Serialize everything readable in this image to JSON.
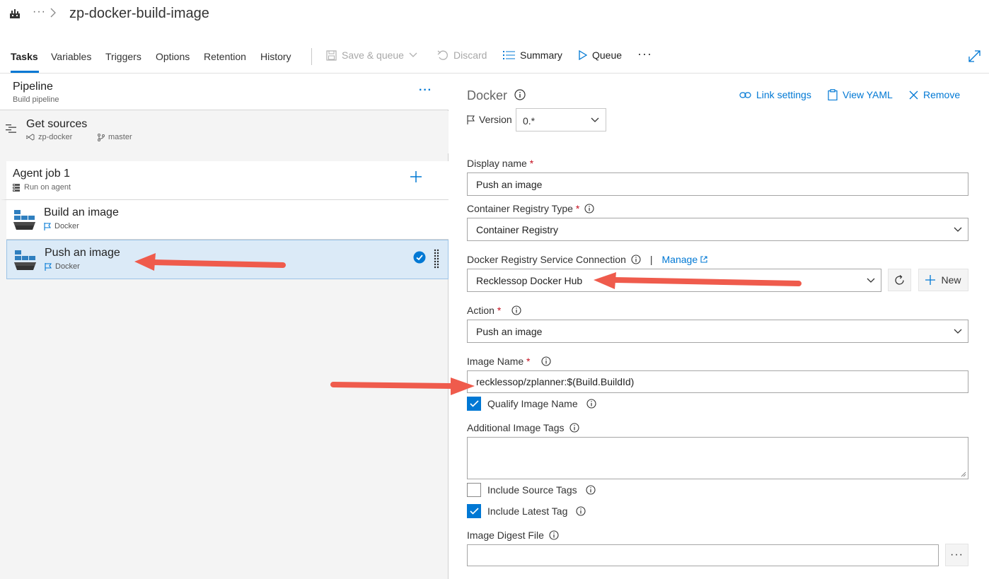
{
  "header": {
    "title": "zp-docker-build-image",
    "more": "···"
  },
  "tabs": [
    {
      "label": "Tasks",
      "active": true
    },
    {
      "label": "Variables"
    },
    {
      "label": "Triggers"
    },
    {
      "label": "Options"
    },
    {
      "label": "Retention"
    },
    {
      "label": "History"
    }
  ],
  "toolbar": {
    "save_queue": "Save & queue",
    "discard": "Discard",
    "summary": "Summary",
    "queue": "Queue",
    "more": "···"
  },
  "pipeline": {
    "title": "Pipeline",
    "subtitle": "Build pipeline",
    "more": "···"
  },
  "get_sources": {
    "title": "Get sources",
    "repo": "zp-docker",
    "branch": "master"
  },
  "agent_job": {
    "title": "Agent job 1",
    "subtitle": "Run on agent"
  },
  "tasks": [
    {
      "title": "Build an image",
      "type": "Docker",
      "selected": false
    },
    {
      "title": "Push an image",
      "type": "Docker",
      "selected": true
    }
  ],
  "panel": {
    "title": "Docker",
    "link_settings": "Link settings",
    "view_yaml": "View YAML",
    "remove": "Remove",
    "version_label": "Version",
    "version_value": "0.*",
    "display_name_label": "Display name",
    "display_name_value": "Push an image",
    "registry_type_label": "Container Registry Type",
    "registry_type_value": "Container Registry",
    "service_conn_label": "Docker Registry Service Connection",
    "separator": "|",
    "manage": "Manage",
    "service_conn_value": "Recklessop Docker Hub",
    "new_label": "New",
    "action_label": "Action",
    "action_value": "Push an image",
    "image_name_label": "Image Name",
    "image_name_value": "recklessop/zplanner:$(Build.BuildId)",
    "qualify_label": "Qualify Image Name",
    "qualify_checked": true,
    "additional_tags_label": "Additional Image Tags",
    "include_source_label": "Include Source Tags",
    "include_source_checked": false,
    "include_latest_label": "Include Latest Tag",
    "include_latest_checked": true,
    "digest_label": "Image Digest File",
    "digest_more": "···"
  },
  "colors": {
    "accent": "#0078d4",
    "selected_bg": "#dbeaf7",
    "required": "#c50f1f",
    "arrow": "#ef5b4c"
  }
}
